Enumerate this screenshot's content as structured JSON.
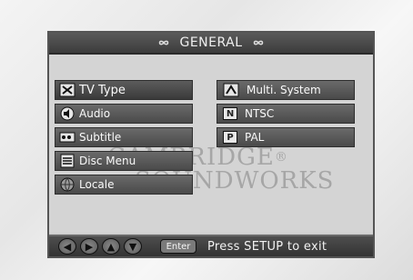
{
  "title": {
    "text": "GENERAL",
    "left_icon": "infinity-icon",
    "right_icon": "infinity-icon"
  },
  "watermark": {
    "line1": "CAMBRIDGE",
    "line2": "SOUNDWORKS",
    "reg": "®"
  },
  "left_menu": [
    {
      "label": "TV Type",
      "icon": "tv-type-icon"
    },
    {
      "label": "Audio",
      "icon": "speaker-icon"
    },
    {
      "label": "Subtitle",
      "icon": "film-icon"
    },
    {
      "label": "Disc Menu",
      "icon": "menu-list-icon"
    },
    {
      "label": "Locale",
      "icon": "globe-icon"
    }
  ],
  "options": [
    {
      "label": "Multi. System",
      "badge": ""
    },
    {
      "label": "NTSC",
      "badge": "N"
    },
    {
      "label": "PAL",
      "badge": "P"
    }
  ],
  "footer": {
    "nav": [
      "◀",
      "▶",
      "▲",
      "▼"
    ],
    "enter": "Enter",
    "hint": "Press SETUP to exit"
  }
}
